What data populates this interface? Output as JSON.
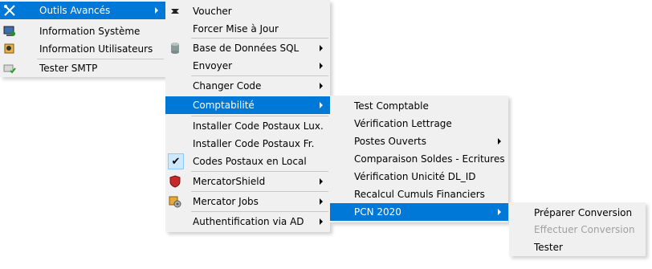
{
  "menus": {
    "main": {
      "items": [
        {
          "label": "Outils Avancés",
          "icon": "tools-icon"
        },
        {
          "label": "Information Système",
          "icon": "system-info-icon"
        },
        {
          "label": "Information Utilisateurs",
          "icon": "users-info-icon"
        },
        {
          "label": "Tester SMTP",
          "icon": "mail-check-icon"
        }
      ]
    },
    "advanced_tools": {
      "items": [
        {
          "label": "Voucher",
          "icon": "voucher-icon"
        },
        {
          "label": "Forcer Mise à Jour"
        },
        {
          "label": "Base de Données SQL",
          "icon": "database-icon"
        },
        {
          "label": "Envoyer"
        },
        {
          "label": "Changer Code"
        },
        {
          "label": "Comptabilité"
        },
        {
          "label": "Installer Code Postaux Lux."
        },
        {
          "label": "Installer Code Postaux Fr."
        },
        {
          "label": "Codes Postaux en Local",
          "checked": true
        },
        {
          "label": "MercatorShield",
          "icon": "shield-icon"
        },
        {
          "label": "Mercator Jobs",
          "icon": "jobs-icon"
        },
        {
          "label": "Authentification via AD"
        }
      ]
    },
    "accounting": {
      "items": [
        {
          "label": "Test Comptable"
        },
        {
          "label": "Vérification Lettrage"
        },
        {
          "label": "Postes Ouverts"
        },
        {
          "label": "Comparaison Soldes - Ecritures"
        },
        {
          "label": "Vérification Unicité DL_ID"
        },
        {
          "label": "Recalcul Cumuls Financiers"
        },
        {
          "label": "PCN 2020"
        }
      ]
    },
    "pcn2020": {
      "items": [
        {
          "label": "Préparer Conversion"
        },
        {
          "label": "Effectuer Conversion",
          "disabled": true
        },
        {
          "label": "Tester"
        }
      ]
    }
  },
  "colors": {
    "highlight": "#0078d7",
    "menu_bg": "#f0f0f0",
    "disabled_text": "#a0a0a0"
  }
}
